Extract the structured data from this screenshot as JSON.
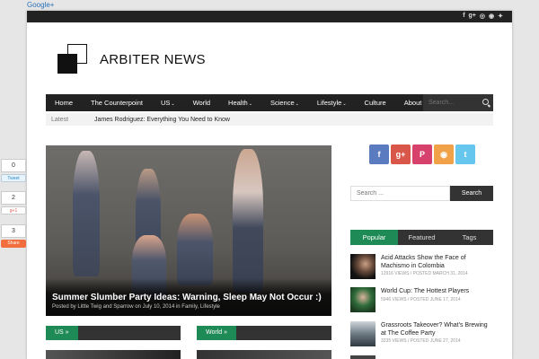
{
  "google_link": "Google+",
  "site": {
    "name": "ARBITER NEWS"
  },
  "top_social": [
    "f",
    "g+",
    "p",
    "rss",
    "t"
  ],
  "nav": {
    "items": [
      {
        "label": "Home",
        "caret": ""
      },
      {
        "label": "The Counterpoint",
        "caret": ""
      },
      {
        "label": "US",
        "caret": "⌄"
      },
      {
        "label": "World",
        "caret": ""
      },
      {
        "label": "Health",
        "caret": "⌄"
      },
      {
        "label": "Science",
        "caret": "⌄"
      },
      {
        "label": "Lifestyle",
        "caret": "⌄"
      },
      {
        "label": "Culture",
        "caret": ""
      },
      {
        "label": "About",
        "caret": ""
      }
    ],
    "search_placeholder": "Search..."
  },
  "ticker": {
    "label": "Latest",
    "text": "James Rodriguez: Everything You Need to Know"
  },
  "hero": {
    "title": "Summer Slumber Party Ideas: Warning, Sleep May Not Occur :)",
    "meta": "Posted by Little Twig and Sparrow on July 10, 2014 in Family, Lifestyle"
  },
  "sections": [
    {
      "label": "US »"
    },
    {
      "label": "World »"
    }
  ],
  "social_box": [
    {
      "icon": "f",
      "name": "facebook-icon",
      "color": "#5a7bbf"
    },
    {
      "icon": "g+",
      "name": "google-plus-icon",
      "color": "#d9574a"
    },
    {
      "icon": "P",
      "name": "pinterest-icon",
      "color": "#d7426c"
    },
    {
      "icon": "◉",
      "name": "rss-icon",
      "color": "#f1a248"
    },
    {
      "icon": "t",
      "name": "twitter-icon",
      "color": "#67c6ee"
    }
  ],
  "side_search": {
    "placeholder": "Search ...",
    "button": "Search"
  },
  "tabs": [
    "Popular",
    "Featured",
    "Tags"
  ],
  "posts": [
    {
      "title": "Acid Attacks Show the Face of Machismo in Colombia",
      "meta": "12916 VIEWS / POSTED MARCH 31, 2014"
    },
    {
      "title": "World Cup: The Hottest Players",
      "meta": "5946 VIEWS / POSTED JUNE 17, 2014"
    },
    {
      "title": "Grassroots Takeover? What's Brewing at The Coffee Party",
      "meta": "3235 VIEWS / POSTED JUNE 27, 2014"
    }
  ],
  "share": [
    {
      "count": "0",
      "button": "Tweet",
      "color": "#e8f4fb",
      "text_color": "#2a8ac6"
    },
    {
      "count": "2",
      "button": "g+1",
      "color": "#fff",
      "text_color": "#d9574a"
    },
    {
      "count": "3",
      "button": "Share",
      "color": "#f26e3c",
      "text_color": "#fff"
    }
  ]
}
